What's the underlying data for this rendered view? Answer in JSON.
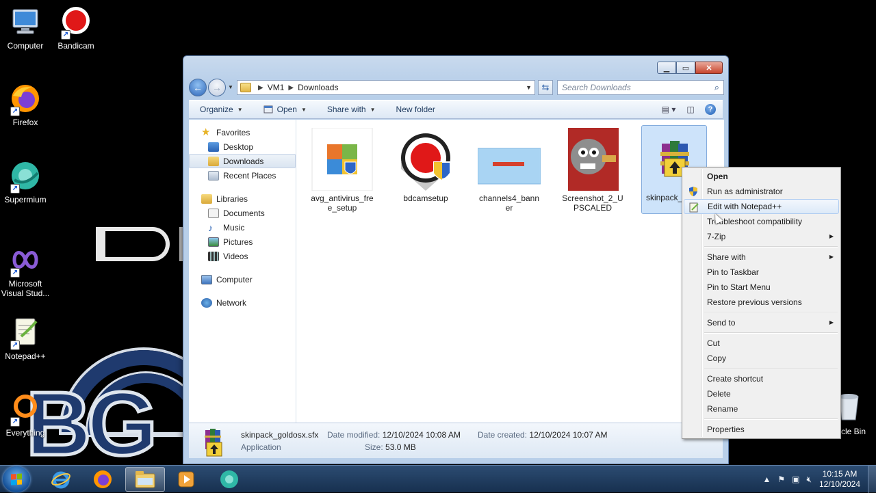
{
  "desktop": {
    "icons": [
      {
        "label": "Computer",
        "icon": "computer-icon"
      },
      {
        "label": "Bandicam",
        "icon": "bandicam-icon"
      },
      {
        "label": "Firefox",
        "icon": "firefox-icon"
      },
      {
        "label": "Supermium",
        "icon": "supermium-icon"
      },
      {
        "label": "Microsoft Visual Stud...",
        "icon": "visual-studio-icon"
      },
      {
        "label": "Notepad++",
        "icon": "notepadpp-icon"
      },
      {
        "label": "Everything",
        "icon": "everything-icon"
      }
    ],
    "recycle_bin_label": "cle Bin"
  },
  "explorer": {
    "breadcrumb": [
      "VM1",
      "Downloads"
    ],
    "search_placeholder": "Search Downloads",
    "toolbar": {
      "organize": "Organize",
      "open": "Open",
      "share_with": "Share with",
      "new_folder": "New folder"
    },
    "nav": {
      "favorites": "Favorites",
      "desktop": "Desktop",
      "downloads": "Downloads",
      "recent_places": "Recent Places",
      "libraries": "Libraries",
      "documents": "Documents",
      "music": "Music",
      "pictures": "Pictures",
      "videos": "Videos",
      "computer": "Computer",
      "network": "Network"
    },
    "files": [
      {
        "name": "avg_antivirus_free_setup"
      },
      {
        "name": "bdcamsetup"
      },
      {
        "name": "channels4_banner"
      },
      {
        "name": "Screenshot_2_UPSCALED"
      },
      {
        "name": "skinpack_g .sfx"
      }
    ],
    "details": {
      "name": "skinpack_goldosx.sfx",
      "type": "Application",
      "date_modified_label": "Date modified:",
      "date_modified": "12/10/2024 10:08 AM",
      "date_created_label": "Date created:",
      "date_created": "12/10/2024 10:07 AM",
      "size_label": "Size:",
      "size": "53.0 MB"
    }
  },
  "context_menu": {
    "open": "Open",
    "run_as_admin": "Run as administrator",
    "edit_notepad": "Edit with Notepad++",
    "troubleshoot": "Troubleshoot compatibility",
    "seven_zip": "7-Zip",
    "share_with": "Share with",
    "pin_taskbar": "Pin to Taskbar",
    "pin_start": "Pin to Start Menu",
    "restore": "Restore previous versions",
    "send_to": "Send to",
    "cut": "Cut",
    "copy": "Copy",
    "create_shortcut": "Create shortcut",
    "delete": "Delete",
    "rename": "Rename",
    "properties": "Properties"
  },
  "taskbar": {
    "time": "10:15 AM",
    "date": "12/10/2024"
  },
  "colors": {
    "selection": "#cde3fa",
    "taskbar": "#1f3a5e",
    "wallpaper_logo": "#1f3a6e"
  }
}
